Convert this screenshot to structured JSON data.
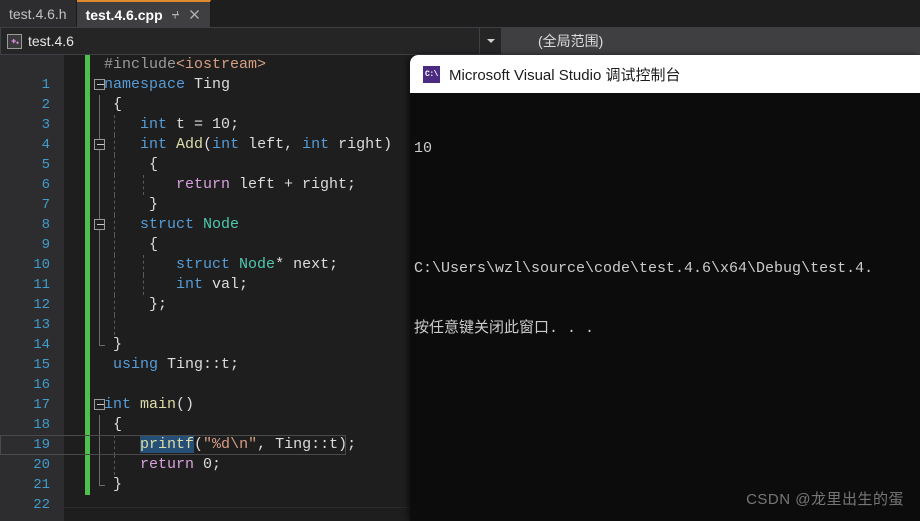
{
  "tabs": [
    {
      "label": "test.4.6.h",
      "active": false
    },
    {
      "label": "test.4.6.cpp",
      "active": true
    }
  ],
  "tab_icons": {
    "pin": "pin-icon",
    "close": "close-icon"
  },
  "navbar": {
    "project_icon": "cpp-project-icon",
    "project": "test.4.6",
    "dropdown_icon": "chevron-down-icon",
    "scope": "(全局范围)"
  },
  "editor": {
    "lines": [
      {
        "n": "1",
        "indent": 0
      },
      {
        "n": "2",
        "indent": 0
      },
      {
        "n": "3",
        "indent": 0
      },
      {
        "n": "4",
        "indent": 0
      },
      {
        "n": "5",
        "indent": 0
      },
      {
        "n": "6",
        "indent": 0
      },
      {
        "n": "7",
        "indent": 0
      },
      {
        "n": "8",
        "indent": 0
      },
      {
        "n": "9",
        "indent": 0
      },
      {
        "n": "10",
        "indent": 0
      },
      {
        "n": "11",
        "indent": 0
      },
      {
        "n": "12",
        "indent": 0
      },
      {
        "n": "13",
        "indent": 0
      },
      {
        "n": "14",
        "indent": 0
      },
      {
        "n": "15",
        "indent": 0
      },
      {
        "n": "16",
        "indent": 0
      },
      {
        "n": "17",
        "indent": 0
      },
      {
        "n": "18",
        "indent": 0
      },
      {
        "n": "19",
        "indent": 0
      },
      {
        "n": "20",
        "indent": 0
      },
      {
        "n": "21",
        "indent": 0
      },
      {
        "n": "22",
        "indent": 0
      }
    ],
    "source_text": [
      "#include<iostream>",
      "namespace Ting",
      "{",
      "    int t = 10;",
      "    int Add(int left, int right)",
      "    {",
      "        return left + right;",
      "    }",
      "    struct Node",
      "    {",
      "        struct Node* next;",
      "        int val;",
      "    };",
      "",
      "}",
      "using Ting::t;",
      "",
      "int main()",
      "{",
      "    printf(\"%d\\n\", Ting::t);",
      "    return 0;",
      "}"
    ],
    "selected_token": "printf",
    "current_line": "20"
  },
  "console": {
    "icon": "console-cmd-icon",
    "title": "Microsoft Visual Studio 调试控制台",
    "output": [
      "10",
      "",
      "C:\\Users\\wzl\\source\\code\\test.4.6\\x64\\Debug\\test.4.",
      "按任意键关闭此窗口. . ."
    ]
  },
  "watermark": "CSDN @龙里出生的蛋",
  "colors": {
    "accent_tab": "#e08a2e",
    "changebar": "#4ec04e",
    "selection": "#264f78",
    "keyword": "#569cd6",
    "type": "#4ec9b0",
    "function": "#dcdcaa",
    "string": "#d69d85",
    "control": "#d8a0df",
    "linenumber": "#3f9ccb"
  }
}
